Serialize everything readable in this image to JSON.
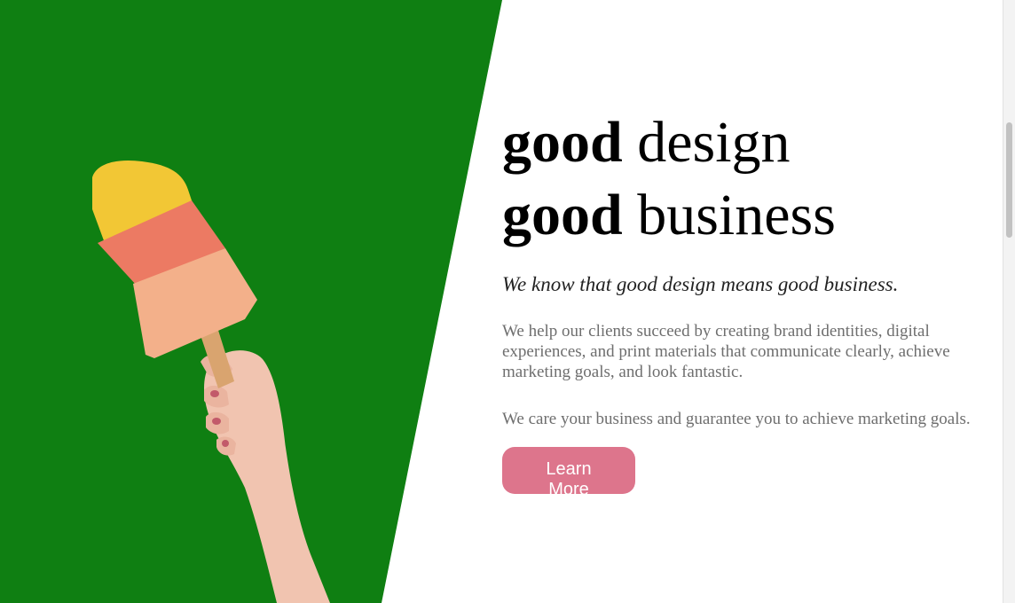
{
  "hero": {
    "headline_line1_bold": "good",
    "headline_line1_rest": " design",
    "headline_line2_bold": "good",
    "headline_line2_rest": " business",
    "tagline": "We know that good design means good business.",
    "paragraph1": "We help our clients succeed by creating brand identities, digital experiences, and print materials that communicate clearly, achieve marketing goals, and look fantastic.",
    "paragraph2": "We care your business and guarantee you to achieve marketing goals.",
    "cta_label": "Learn More"
  },
  "image": {
    "subject": "hand-holding-popsicle-image",
    "background_color": "#0f7f12"
  },
  "colors": {
    "accent": "#dd758c",
    "green": "#0f7f12"
  }
}
